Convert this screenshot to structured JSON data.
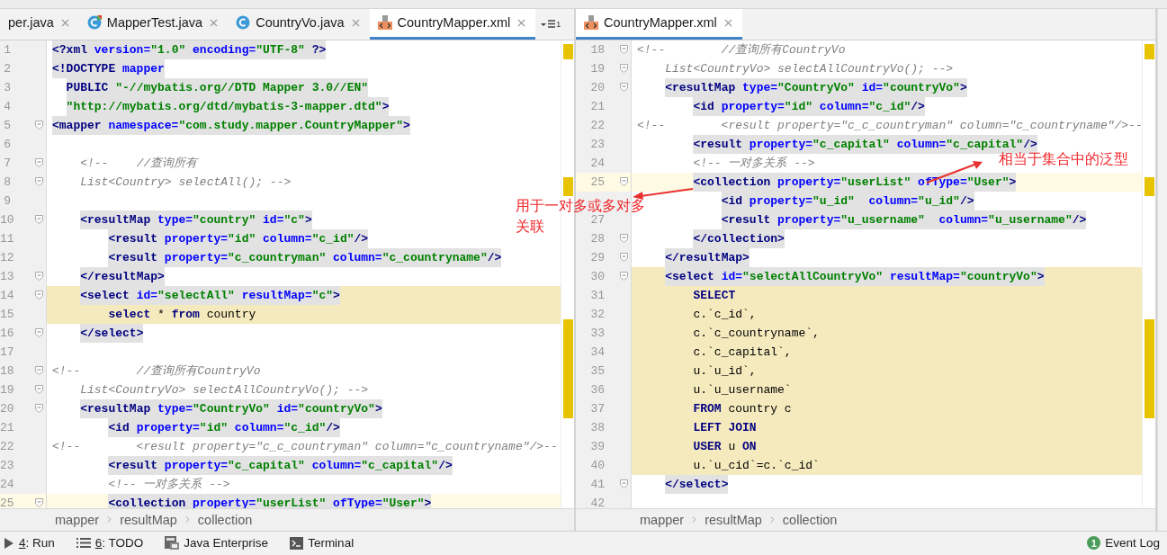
{
  "left_pane": {
    "tabs": [
      {
        "label": "per.java",
        "selected": false
      },
      {
        "label": "MapperTest.java",
        "kind": "test-class",
        "selected": false
      },
      {
        "label": "CountryVo.java",
        "kind": "class",
        "selected": false
      },
      {
        "label": "CountryMapper.xml",
        "kind": "xml",
        "selected": true
      }
    ],
    "tab_menu": {
      "count": "1"
    },
    "lines": [
      {
        "number": "1",
        "fold": false,
        "shaded": true,
        "highlighted": false,
        "current": false,
        "tokens": [
          {
            "kind": "tag",
            "text": "<?xml"
          },
          {
            "kind": "attr",
            "text": " version="
          },
          {
            "kind": "string",
            "text": "\"1.0\""
          },
          {
            "kind": "attr",
            "text": " encoding="
          },
          {
            "kind": "string",
            "text": "\"UTF-8\""
          },
          {
            "kind": "tag",
            "text": " ?>"
          }
        ]
      },
      {
        "number": "2",
        "fold": false,
        "shaded": true,
        "highlighted": false,
        "current": false,
        "tokens": [
          {
            "kind": "tag",
            "text": "<!DOCTYPE"
          },
          {
            "kind": "attr",
            "text": " mapper"
          }
        ]
      },
      {
        "number": "3",
        "fold": false,
        "shaded": true,
        "highlighted": false,
        "current": false,
        "tokens": [
          {
            "kind": "tag",
            "text": "  PUBLIC"
          },
          {
            "kind": "string",
            "text": " \"-//mybatis.org//DTD Mapper 3.0//EN\""
          }
        ]
      },
      {
        "number": "4",
        "fold": false,
        "shaded": true,
        "highlighted": false,
        "current": false,
        "tokens": [
          {
            "kind": "string",
            "text": "  \"http://mybatis.org/dtd/mybatis-3-mapper.dtd\""
          },
          {
            "kind": "tag",
            "text": ">"
          }
        ]
      },
      {
        "number": "5",
        "fold": true,
        "shaded": true,
        "highlighted": false,
        "current": false,
        "tokens": [
          {
            "kind": "tag",
            "text": "<mapper"
          },
          {
            "kind": "attr",
            "text": " namespace="
          },
          {
            "kind": "string",
            "text": "\"com.study.mapper.CountryMapper\""
          },
          {
            "kind": "tag",
            "text": ">"
          }
        ]
      },
      {
        "number": "6",
        "fold": false,
        "highlighted": false,
        "current": false
      },
      {
        "number": "7",
        "fold": true,
        "shaded": false,
        "highlighted": false,
        "current": false,
        "tokens": [
          {
            "kind": "comment",
            "text": "    <!--    //查询所有"
          }
        ]
      },
      {
        "number": "8",
        "fold": true,
        "shaded": false,
        "highlighted": false,
        "current": false,
        "tokens": [
          {
            "kind": "comment",
            "text": "    List<Country> selectAll(); -->"
          }
        ]
      },
      {
        "number": "9",
        "fold": false,
        "highlighted": false,
        "current": false
      },
      {
        "number": "10",
        "fold": true,
        "shaded": true,
        "highlighted": false,
        "current": false,
        "tokens": [
          {
            "kind": "tag",
            "text": "    <resultMap"
          },
          {
            "kind": "attr",
            "text": " type="
          },
          {
            "kind": "string",
            "text": "\"country\""
          },
          {
            "kind": "attr",
            "text": " id="
          },
          {
            "kind": "string",
            "text": "\"c\""
          },
          {
            "kind": "tag",
            "text": ">"
          }
        ]
      },
      {
        "number": "11",
        "fold": false,
        "shaded": true,
        "highlighted": false,
        "current": false,
        "tokens": [
          {
            "kind": "tag",
            "text": "        <result"
          },
          {
            "kind": "attr",
            "text": " property="
          },
          {
            "kind": "string",
            "text": "\"id\""
          },
          {
            "kind": "attr",
            "text": " column="
          },
          {
            "kind": "string",
            "text": "\"c_id\""
          },
          {
            "kind": "tag",
            "text": "/>"
          }
        ]
      },
      {
        "number": "12",
        "fold": false,
        "shaded": true,
        "highlighted": false,
        "current": false,
        "tokens": [
          {
            "kind": "tag",
            "text": "        <result"
          },
          {
            "kind": "attr",
            "text": " property="
          },
          {
            "kind": "string",
            "text": "\"c_countryman\""
          },
          {
            "kind": "attr",
            "text": " column="
          },
          {
            "kind": "string",
            "text": "\"c_countryname\""
          },
          {
            "kind": "tag",
            "text": "/>"
          }
        ]
      },
      {
        "number": "13",
        "fold": true,
        "shaded": true,
        "highlighted": false,
        "current": false,
        "tokens": [
          {
            "kind": "tag",
            "text": "    </resultMap>"
          }
        ]
      },
      {
        "number": "14",
        "fold": true,
        "shaded": true,
        "highlighted": true,
        "current": false,
        "tokens": [
          {
            "kind": "tag",
            "text": "    <select"
          },
          {
            "kind": "attr",
            "text": " id="
          },
          {
            "kind": "string",
            "text": "\"selectAll\""
          },
          {
            "kind": "attr",
            "text": " resultMap="
          },
          {
            "kind": "string",
            "text": "\"c\""
          },
          {
            "kind": "tag",
            "text": ">"
          }
        ]
      },
      {
        "number": "15",
        "fold": false,
        "shaded": false,
        "highlighted": true,
        "current": false,
        "tokens": [
          {
            "kind": "keyword",
            "text": "        select"
          },
          {
            "kind": "plain",
            "text": " * "
          },
          {
            "kind": "keyword",
            "text": "from"
          },
          {
            "kind": "plain",
            "text": " country"
          }
        ]
      },
      {
        "number": "16",
        "fold": true,
        "shaded": true,
        "highlighted": false,
        "current": false,
        "tokens": [
          {
            "kind": "tag",
            "text": "    </select>"
          }
        ]
      },
      {
        "number": "17",
        "fold": false,
        "highlighted": false,
        "current": false
      },
      {
        "number": "18",
        "fold": true,
        "shaded": false,
        "highlighted": false,
        "current": false,
        "tokens": [
          {
            "kind": "comment",
            "text": "<!--        //查询所有CountryVo"
          }
        ]
      },
      {
        "number": "19",
        "fold": true,
        "shaded": false,
        "highlighted": false,
        "current": false,
        "tokens": [
          {
            "kind": "comment",
            "text": "    List<CountryVo> selectAllCountryVo(); -->"
          }
        ]
      },
      {
        "number": "20",
        "fold": true,
        "shaded": true,
        "highlighted": false,
        "current": false,
        "tokens": [
          {
            "kind": "tag",
            "text": "    <resultMap"
          },
          {
            "kind": "attr",
            "text": " type="
          },
          {
            "kind": "string",
            "text": "\"CountryVo\""
          },
          {
            "kind": "attr",
            "text": " id="
          },
          {
            "kind": "string",
            "text": "\"countryVo\""
          },
          {
            "kind": "tag",
            "text": ">"
          }
        ]
      },
      {
        "number": "21",
        "fold": false,
        "shaded": true,
        "highlighted": false,
        "current": false,
        "tokens": [
          {
            "kind": "tag",
            "text": "        <id"
          },
          {
            "kind": "attr",
            "text": " property="
          },
          {
            "kind": "string",
            "text": "\"id\""
          },
          {
            "kind": "attr",
            "text": " column="
          },
          {
            "kind": "string",
            "text": "\"c_id\""
          },
          {
            "kind": "tag",
            "text": "/>"
          }
        ]
      },
      {
        "number": "22",
        "fold": false,
        "shaded": false,
        "highlighted": false,
        "current": false,
        "tokens": [
          {
            "kind": "comment",
            "text": "<!--        <result property=\"c_c_countryman\" column=\"c_countryname\"/>--"
          }
        ]
      },
      {
        "number": "23",
        "fold": false,
        "shaded": true,
        "highlighted": false,
        "current": false,
        "tokens": [
          {
            "kind": "tag",
            "text": "        <result"
          },
          {
            "kind": "attr",
            "text": " property="
          },
          {
            "kind": "string",
            "text": "\"c_capital\""
          },
          {
            "kind": "attr",
            "text": " column="
          },
          {
            "kind": "string",
            "text": "\"c_capital\""
          },
          {
            "kind": "tag",
            "text": "/>"
          }
        ]
      },
      {
        "number": "24",
        "fold": false,
        "shaded": false,
        "highlighted": false,
        "current": false,
        "tokens": [
          {
            "kind": "comment",
            "text": "        <!-- 一对多关系 -->"
          }
        ]
      },
      {
        "number": "25",
        "fold": true,
        "shaded": true,
        "highlighted": false,
        "current": true,
        "tokens": [
          {
            "kind": "tag",
            "text": "        <collection"
          },
          {
            "kind": "attr",
            "text": " property="
          },
          {
            "kind": "string",
            "text": "\"userList\""
          },
          {
            "kind": "attr",
            "text": " ofType="
          },
          {
            "kind": "string",
            "text": "\"User\""
          },
          {
            "kind": "tag",
            "text": ">"
          }
        ]
      }
    ],
    "breadcrumb": [
      "mapper",
      "resultMap",
      "collection"
    ]
  },
  "right_pane": {
    "tabs": [
      {
        "label": "CountryMapper.xml",
        "kind": "xml",
        "selected": true
      }
    ],
    "lines": [
      {
        "number": "18",
        "fold": true,
        "shaded": false,
        "highlighted": false,
        "current": false,
        "tokens": [
          {
            "kind": "comment",
            "text": "<!--        //查询所有CountryVo"
          }
        ]
      },
      {
        "number": "19",
        "fold": true,
        "shaded": false,
        "highlighted": false,
        "current": false,
        "tokens": [
          {
            "kind": "comment",
            "text": "    List<CountryVo> selectAllCountryVo(); -->"
          }
        ]
      },
      {
        "number": "20",
        "fold": true,
        "shaded": true,
        "highlighted": false,
        "current": false,
        "tokens": [
          {
            "kind": "tag",
            "text": "    <resultMap"
          },
          {
            "kind": "attr",
            "text": " type="
          },
          {
            "kind": "string",
            "text": "\"CountryVo\""
          },
          {
            "kind": "attr",
            "text": " id="
          },
          {
            "kind": "string",
            "text": "\"countryVo\""
          },
          {
            "kind": "tag",
            "text": ">"
          }
        ]
      },
      {
        "number": "21",
        "fold": false,
        "shaded": true,
        "highlighted": false,
        "current": false,
        "tokens": [
          {
            "kind": "tag",
            "text": "        <id"
          },
          {
            "kind": "attr",
            "text": " property="
          },
          {
            "kind": "string",
            "text": "\"id\""
          },
          {
            "kind": "attr",
            "text": " column="
          },
          {
            "kind": "string",
            "text": "\"c_id\""
          },
          {
            "kind": "tag",
            "text": "/>"
          }
        ]
      },
      {
        "number": "22",
        "fold": false,
        "shaded": false,
        "highlighted": false,
        "current": false,
        "tokens": [
          {
            "kind": "comment",
            "text": "<!--        <result property=\"c_c_countryman\" column=\"c_countryname\"/>--"
          }
        ]
      },
      {
        "number": "23",
        "fold": false,
        "shaded": true,
        "highlighted": false,
        "current": false,
        "tokens": [
          {
            "kind": "tag",
            "text": "        <result"
          },
          {
            "kind": "attr",
            "text": " property="
          },
          {
            "kind": "string",
            "text": "\"c_capital\""
          },
          {
            "kind": "attr",
            "text": " column="
          },
          {
            "kind": "string",
            "text": "\"c_capital\""
          },
          {
            "kind": "tag",
            "text": "/>"
          }
        ]
      },
      {
        "number": "24",
        "fold": false,
        "shaded": false,
        "highlighted": false,
        "current": false,
        "tokens": [
          {
            "kind": "comment",
            "text": "        <!-- 一对多关系 -->"
          }
        ]
      },
      {
        "number": "25",
        "fold": true,
        "shaded": true,
        "highlighted": false,
        "current": true,
        "tokens": [
          {
            "kind": "tag",
            "text": "        <collection"
          },
          {
            "kind": "attr",
            "text": " property="
          },
          {
            "kind": "string",
            "text": "\"userList\""
          },
          {
            "kind": "attr",
            "text": " ofType="
          },
          {
            "kind": "string",
            "text": "\"User\""
          },
          {
            "kind": "tag",
            "text": ">"
          }
        ]
      },
      {
        "fold": false,
        "shaded": true,
        "highlighted": false,
        "current": false,
        "tokens": [
          {
            "kind": "tag",
            "text": "            <id"
          },
          {
            "kind": "attr",
            "text": " property="
          },
          {
            "kind": "string",
            "text": "\"u_id\""
          },
          {
            "kind": "attr",
            "text": "  column="
          },
          {
            "kind": "string",
            "text": "\"u_id\""
          },
          {
            "kind": "tag",
            "text": "/>"
          }
        ]
      },
      {
        "number": "27",
        "fold": false,
        "shaded": true,
        "highlighted": false,
        "current": false,
        "tokens": [
          {
            "kind": "tag",
            "text": "            <result"
          },
          {
            "kind": "attr",
            "text": " property="
          },
          {
            "kind": "string",
            "text": "\"u_username\""
          },
          {
            "kind": "attr",
            "text": "  column="
          },
          {
            "kind": "string",
            "text": "\"u_username\""
          },
          {
            "kind": "tag",
            "text": "/>"
          }
        ]
      },
      {
        "number": "28",
        "fold": true,
        "shaded": true,
        "highlighted": false,
        "current": false,
        "tokens": [
          {
            "kind": "tag",
            "text": "        </collection>"
          }
        ]
      },
      {
        "number": "29",
        "fold": true,
        "shaded": true,
        "highlighted": false,
        "current": false,
        "tokens": [
          {
            "kind": "tag",
            "text": "    </resultMap>"
          }
        ]
      },
      {
        "number": "30",
        "fold": true,
        "shaded": true,
        "highlighted": true,
        "current": false,
        "tokens": [
          {
            "kind": "tag",
            "text": "    <select"
          },
          {
            "kind": "attr",
            "text": " id="
          },
          {
            "kind": "string",
            "text": "\"selectAllCountryVo\""
          },
          {
            "kind": "attr",
            "text": " resultMap="
          },
          {
            "kind": "string",
            "text": "\"countryVo\""
          },
          {
            "kind": "tag",
            "text": ">"
          }
        ]
      },
      {
        "number": "31",
        "fold": false,
        "shaded": false,
        "highlighted": true,
        "current": false,
        "tokens": [
          {
            "kind": "keyword",
            "text": "        SELECT"
          }
        ]
      },
      {
        "number": "32",
        "fold": false,
        "shaded": false,
        "highlighted": true,
        "current": false,
        "tokens": [
          {
            "kind": "plain",
            "text": "        c.`c_id`,"
          }
        ]
      },
      {
        "number": "33",
        "fold": false,
        "shaded": false,
        "highlighted": true,
        "current": false,
        "tokens": [
          {
            "kind": "plain",
            "text": "        c.`c_countryname`,"
          }
        ]
      },
      {
        "number": "34",
        "fold": false,
        "shaded": false,
        "highlighted": true,
        "current": false,
        "tokens": [
          {
            "kind": "plain",
            "text": "        c.`c_capital`,"
          }
        ]
      },
      {
        "number": "35",
        "fold": false,
        "shaded": false,
        "highlighted": true,
        "current": false,
        "tokens": [
          {
            "kind": "plain",
            "text": "        u.`u_id`,"
          }
        ]
      },
      {
        "number": "36",
        "fold": false,
        "shaded": false,
        "highlighted": true,
        "current": false,
        "tokens": [
          {
            "kind": "plain",
            "text": "        u.`u_username`"
          }
        ]
      },
      {
        "number": "37",
        "fold": false,
        "shaded": false,
        "highlighted": true,
        "current": false,
        "tokens": [
          {
            "kind": "keyword",
            "text": "        FROM"
          },
          {
            "kind": "plain",
            "text": " country c"
          }
        ]
      },
      {
        "number": "38",
        "fold": false,
        "shaded": false,
        "highlighted": true,
        "current": false,
        "tokens": [
          {
            "kind": "keyword",
            "text": "        LEFT JOIN"
          }
        ]
      },
      {
        "number": "39",
        "fold": false,
        "shaded": false,
        "highlighted": true,
        "current": false,
        "tokens": [
          {
            "kind": "keyword",
            "text": "        USER"
          },
          {
            "kind": "plain",
            "text": " u "
          },
          {
            "kind": "keyword",
            "text": "ON"
          }
        ]
      },
      {
        "number": "40",
        "fold": false,
        "shaded": false,
        "highlighted": true,
        "current": false,
        "tokens": [
          {
            "kind": "plain",
            "text": "        u.`u_cid`=c.`c_id`"
          }
        ]
      },
      {
        "number": "41",
        "fold": true,
        "shaded": true,
        "highlighted": false,
        "current": false,
        "tokens": [
          {
            "kind": "tag",
            "text": "    </select>"
          }
        ]
      },
      {
        "number": "42",
        "fold": false,
        "highlighted": false,
        "current": false
      }
    ],
    "breadcrumb": [
      "mapper",
      "resultMap",
      "collection"
    ]
  },
  "annotations": [
    {
      "text": "用于一对多或多对多"
    },
    {
      "text": "关联"
    },
    {
      "text": "相当于集合中的泛型"
    }
  ],
  "bottom_bar": {
    "tools": [
      {
        "mnemonic": "4",
        "label": ": Run",
        "kind": "run"
      },
      {
        "mnemonic": "6",
        "label": ": TODO",
        "kind": "todo"
      },
      {
        "label": "Java Enterprise",
        "kind": "enterprise"
      },
      {
        "label": "Terminal",
        "kind": "terminal"
      }
    ],
    "event_log": {
      "count": "1",
      "label": "Event Log"
    }
  }
}
